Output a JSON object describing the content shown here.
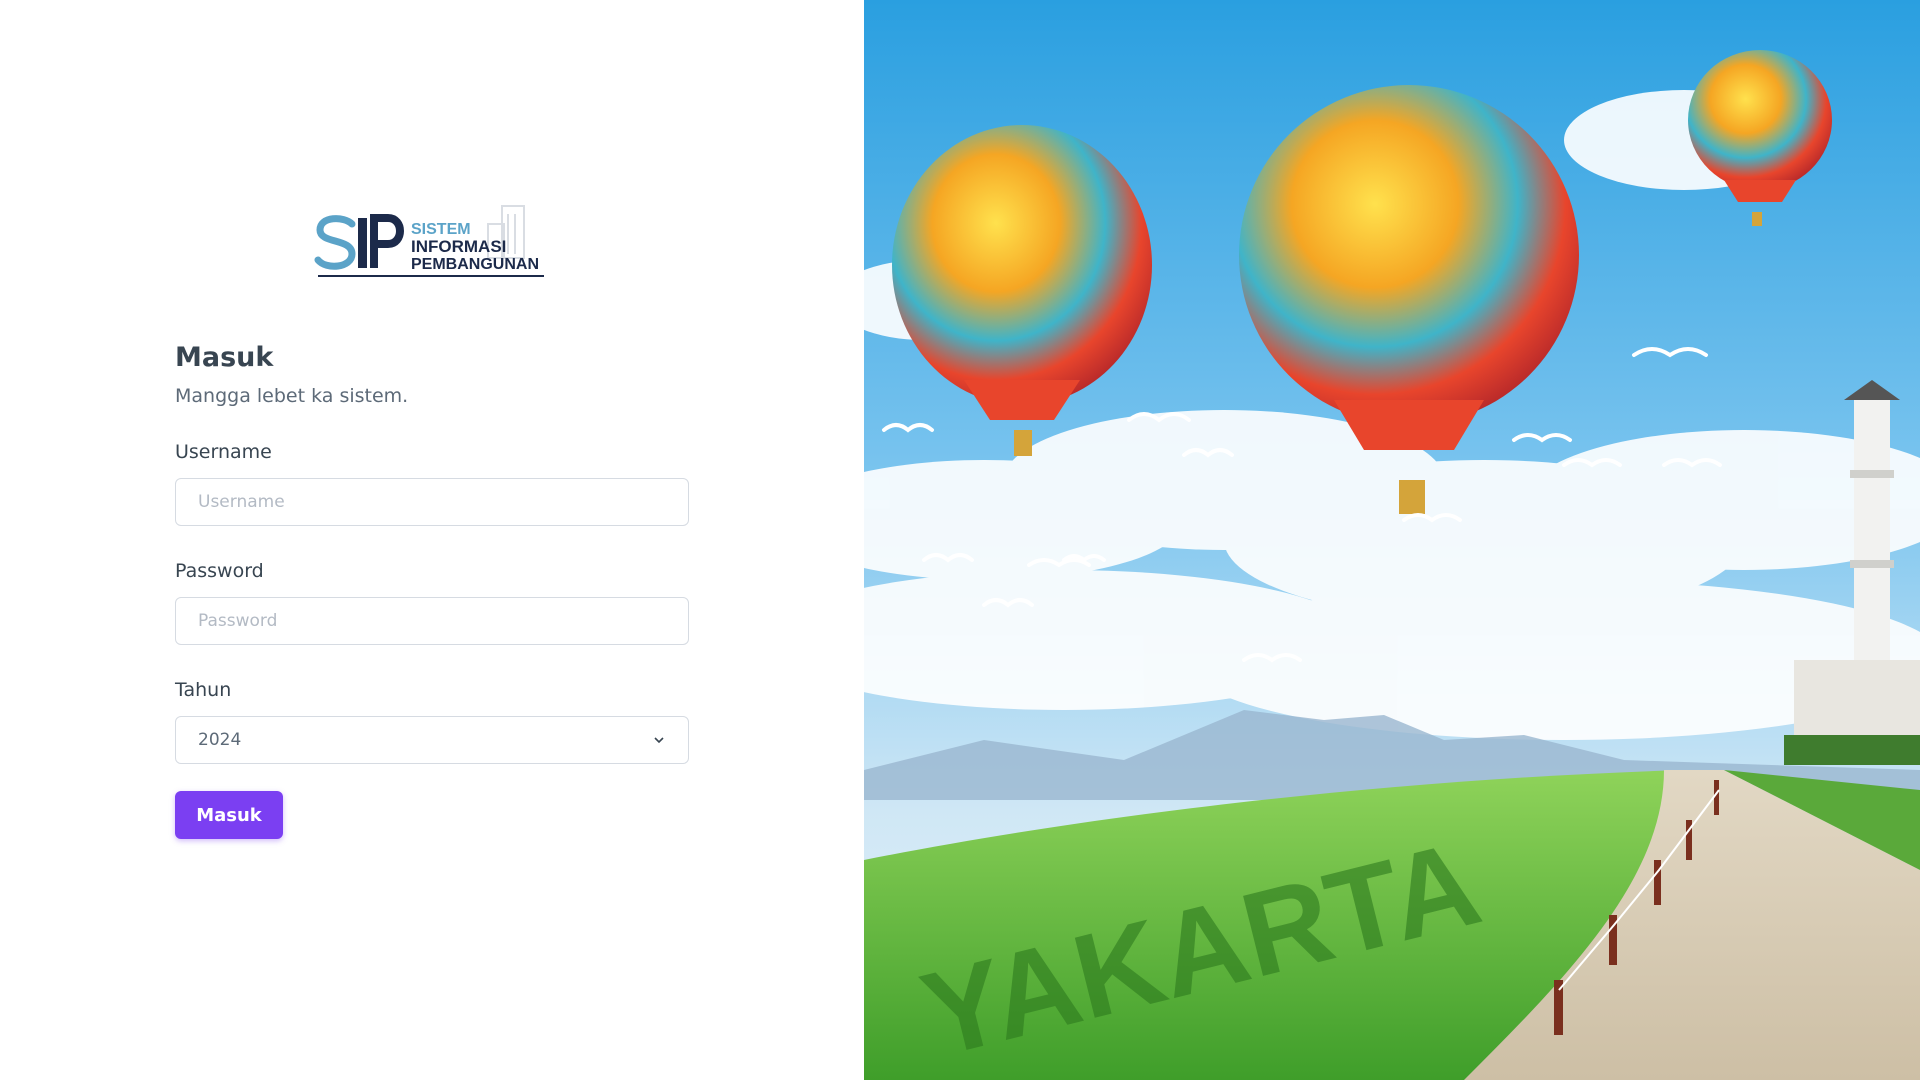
{
  "logo": {
    "monogram": "SIP",
    "line1": "SISTEM",
    "line2": "INFORMASI",
    "line3": "PEMBANGUNAN"
  },
  "login": {
    "title": "Masuk",
    "subtitle": "Mangga lebet ka sistem.",
    "username_label": "Username",
    "username_placeholder": "Username",
    "username_value": "",
    "password_label": "Password",
    "password_placeholder": "Password",
    "password_value": "",
    "year_label": "Tahun",
    "year_selected": "2024",
    "submit_label": "Masuk"
  },
  "hero": {
    "grass_text": "YAKARTA"
  },
  "colors": {
    "accent": "#7b3ff2",
    "text_dark": "#384551",
    "text_muted": "#5d6a78",
    "border": "#d6dbe2",
    "logo_blue": "#5ba3c8",
    "logo_navy": "#1c2a4a"
  }
}
